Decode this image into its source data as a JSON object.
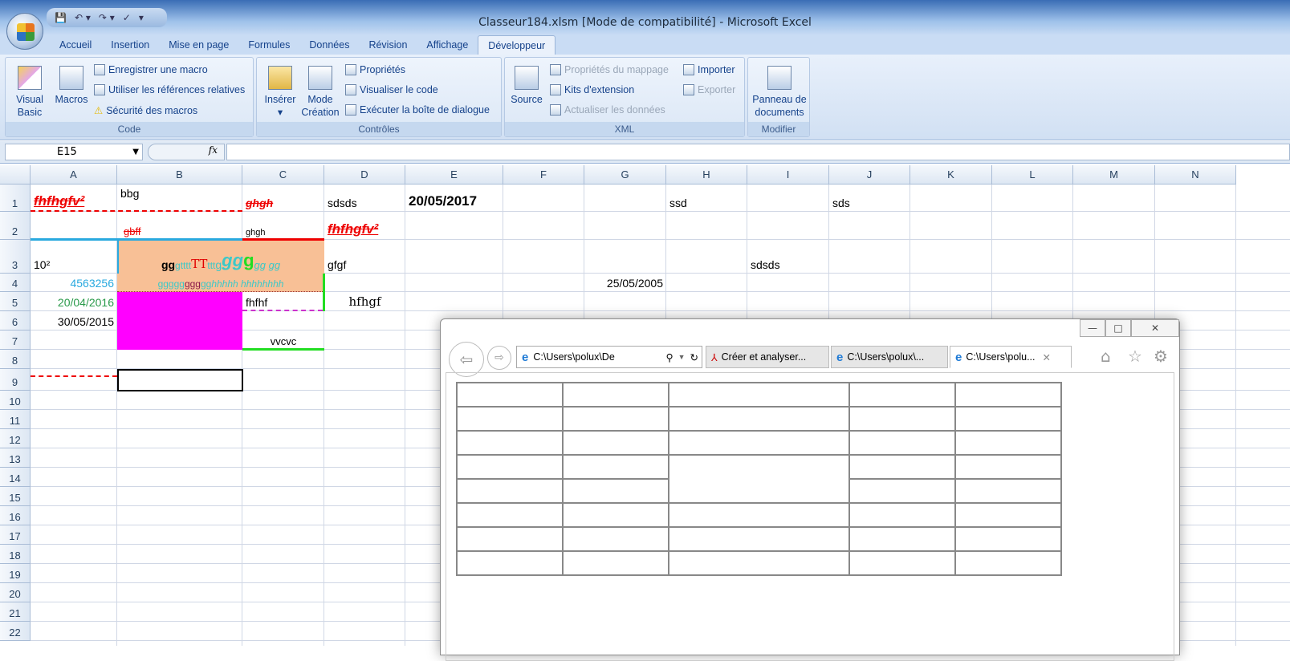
{
  "window": {
    "title": "Classeur184.xlsm  [Mode de compatibilité] - Microsoft Excel"
  },
  "qat": {
    "icons": [
      "save-icon",
      "undo-icon",
      "redo-icon",
      "spellcheck-icon",
      "customize-icon"
    ]
  },
  "ribbon_tabs": [
    {
      "label": "Accueil"
    },
    {
      "label": "Insertion"
    },
    {
      "label": "Mise en page"
    },
    {
      "label": "Formules"
    },
    {
      "label": "Données"
    },
    {
      "label": "Révision"
    },
    {
      "label": "Affichage"
    },
    {
      "label": "Développeur",
      "active": true
    }
  ],
  "groups": {
    "code": {
      "label": "Code",
      "visual_basic": "Visual Basic",
      "macros": "Macros",
      "record": "Enregistrer une macro",
      "relative": "Utiliser les références relatives",
      "security": "Sécurité des macros"
    },
    "controls": {
      "label": "Contrôles",
      "insert": "Insérer",
      "mode": "Mode Création",
      "properties": "Propriétés",
      "view_code": "Visualiser le code",
      "run_dialog": "Exécuter la boîte de dialogue"
    },
    "xml": {
      "label": "XML",
      "source": "Source",
      "map_props": "Propriétés du mappage",
      "expansion": "Kits d'extension",
      "refresh": "Actualiser les données",
      "import": "Importer",
      "export": "Exporter"
    },
    "modify": {
      "label": "Modifier",
      "doc_panel": "Panneau de documents"
    }
  },
  "formula_bar": {
    "name_box": "E15",
    "fx": "fx",
    "formula": ""
  },
  "columns": [
    "A",
    "B",
    "C",
    "D",
    "E",
    "F",
    "G",
    "H",
    "I",
    "J",
    "K",
    "L",
    "M",
    "N"
  ],
  "rows": [
    "1",
    "2",
    "3",
    "4",
    "5",
    "6",
    "7",
    "8",
    "9",
    "10",
    "11",
    "12",
    "13",
    "14",
    "15",
    "16",
    "17",
    "18",
    "19",
    "20",
    "21",
    "22"
  ],
  "cells": [
    {
      "ref": "A1",
      "text": "fhfhgfv²",
      "style": "redbig"
    },
    {
      "ref": "B1",
      "text": "bbg",
      "style": "top"
    },
    {
      "ref": "C1",
      "text": "ghgh",
      "style": "redstrike"
    },
    {
      "ref": "D1",
      "text": "sdsds"
    },
    {
      "ref": "E1",
      "text": "20/05/2017",
      "style": "bold"
    },
    {
      "ref": "H1",
      "text": "ssd"
    },
    {
      "ref": "J1",
      "text": "sds"
    },
    {
      "ref": "B2",
      "text": "gbff",
      "style": "redthin"
    },
    {
      "ref": "C2",
      "text": "ghgh",
      "style": "small"
    },
    {
      "ref": "D2",
      "text": "fhfhgfv²",
      "style": "redbig"
    },
    {
      "ref": "A3",
      "text": "10²"
    },
    {
      "ref": "D3",
      "text": "gfgf"
    },
    {
      "ref": "I3",
      "text": "sdsds"
    },
    {
      "ref": "A4",
      "text": "4563256",
      "style": "rightblue"
    },
    {
      "ref": "G4",
      "text": "25/05/2005",
      "style": "right"
    },
    {
      "ref": "A5",
      "text": "20/04/2016",
      "style": "rightgreen"
    },
    {
      "ref": "C5",
      "text": "fhfhf"
    },
    {
      "ref": "D5",
      "text": "hfhgf",
      "style": "serifcenter"
    },
    {
      "ref": "A6",
      "text": "30/05/2015",
      "style": "right"
    },
    {
      "ref": "C7",
      "text": "vvcvc",
      "style": "center"
    }
  ],
  "rich_b3": [
    {
      "text": "gg",
      "color": "#000000"
    },
    {
      "text": "gtttt",
      "color": "#3cc8c8"
    },
    {
      "text": "TT",
      "color": "#e00000"
    },
    {
      "text": "ttt",
      "color": "#3cc8c8"
    },
    {
      "text": "g",
      "color": "#3cc8c8"
    },
    {
      "text": "gg ",
      "color": "#3cc8c8"
    },
    {
      "text": "g",
      "color": "#22dd22"
    },
    {
      "text": "gg gg",
      "color": "#3cc8c8"
    }
  ],
  "rich_b4": [
    {
      "text": "ggggg",
      "color": "#3cc8c8"
    },
    {
      "text": "ggg",
      "color": "#8b1a4a"
    },
    {
      "text": "gg",
      "color": "#3cc8c8"
    },
    {
      "text": "hhhhh hhhhhhhh",
      "color": "#3cc8c8"
    }
  ],
  "colors": {
    "b3_fill": "#f8c096",
    "b5_fill": "#ff00ff",
    "accent": "#15428b"
  },
  "ie": {
    "address": "C:\\Users\\polux\\De",
    "tabs": [
      {
        "label": "Créer et analyser..."
      },
      {
        "label": "C:\\Users\\polux\\..."
      },
      {
        "label": "C:\\Users\\polu...",
        "active": true
      }
    ],
    "controls": {
      "min": "—",
      "max": "□",
      "close": "✕"
    },
    "table_rows": 8,
    "table_cols": 5
  }
}
